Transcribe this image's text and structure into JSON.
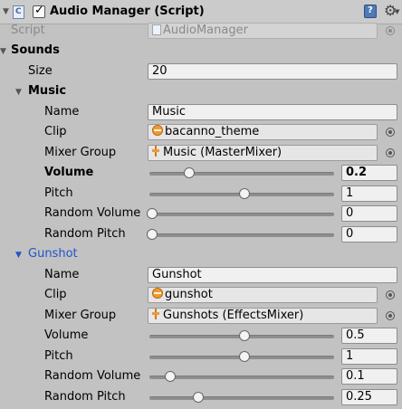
{
  "component": {
    "title": "Audio Manager (Script)",
    "script_label": "Script",
    "script_value": "AudioManager"
  },
  "sounds": {
    "label": "Sounds",
    "size_label": "Size",
    "size_value": "20",
    "field_labels": {
      "name": "Name",
      "clip": "Clip",
      "mixer": "Mixer Group",
      "volume": "Volume",
      "pitch": "Pitch",
      "random_volume": "Random Volume",
      "random_pitch": "Random Pitch"
    },
    "items": [
      {
        "label": "Music",
        "name": "Music",
        "clip": "bacanno_theme",
        "mixer": "Music (MasterMixer)",
        "volume": "0.2",
        "pitch": "1",
        "random_volume": "0",
        "random_pitch": "0"
      },
      {
        "label": "Gunshot",
        "name": "Gunshot",
        "clip": "gunshot",
        "mixer": "Gunshots (EffectsMixer)",
        "volume": "0.5",
        "pitch": "1",
        "random_volume": "0.1",
        "random_pitch": "0.25"
      }
    ]
  },
  "sliders": {
    "music_volume": 0.2,
    "music_pitch": 0.5,
    "music_random_volume": 0,
    "music_random_pitch": 0,
    "gunshot_volume": 0.5,
    "gunshot_pitch": 0.5,
    "gunshot_random_volume": 0.1,
    "gunshot_random_pitch": 0.25
  },
  "colors": {
    "selected_label": "#2254c7",
    "slider_thumb": "#f4f4f4"
  }
}
